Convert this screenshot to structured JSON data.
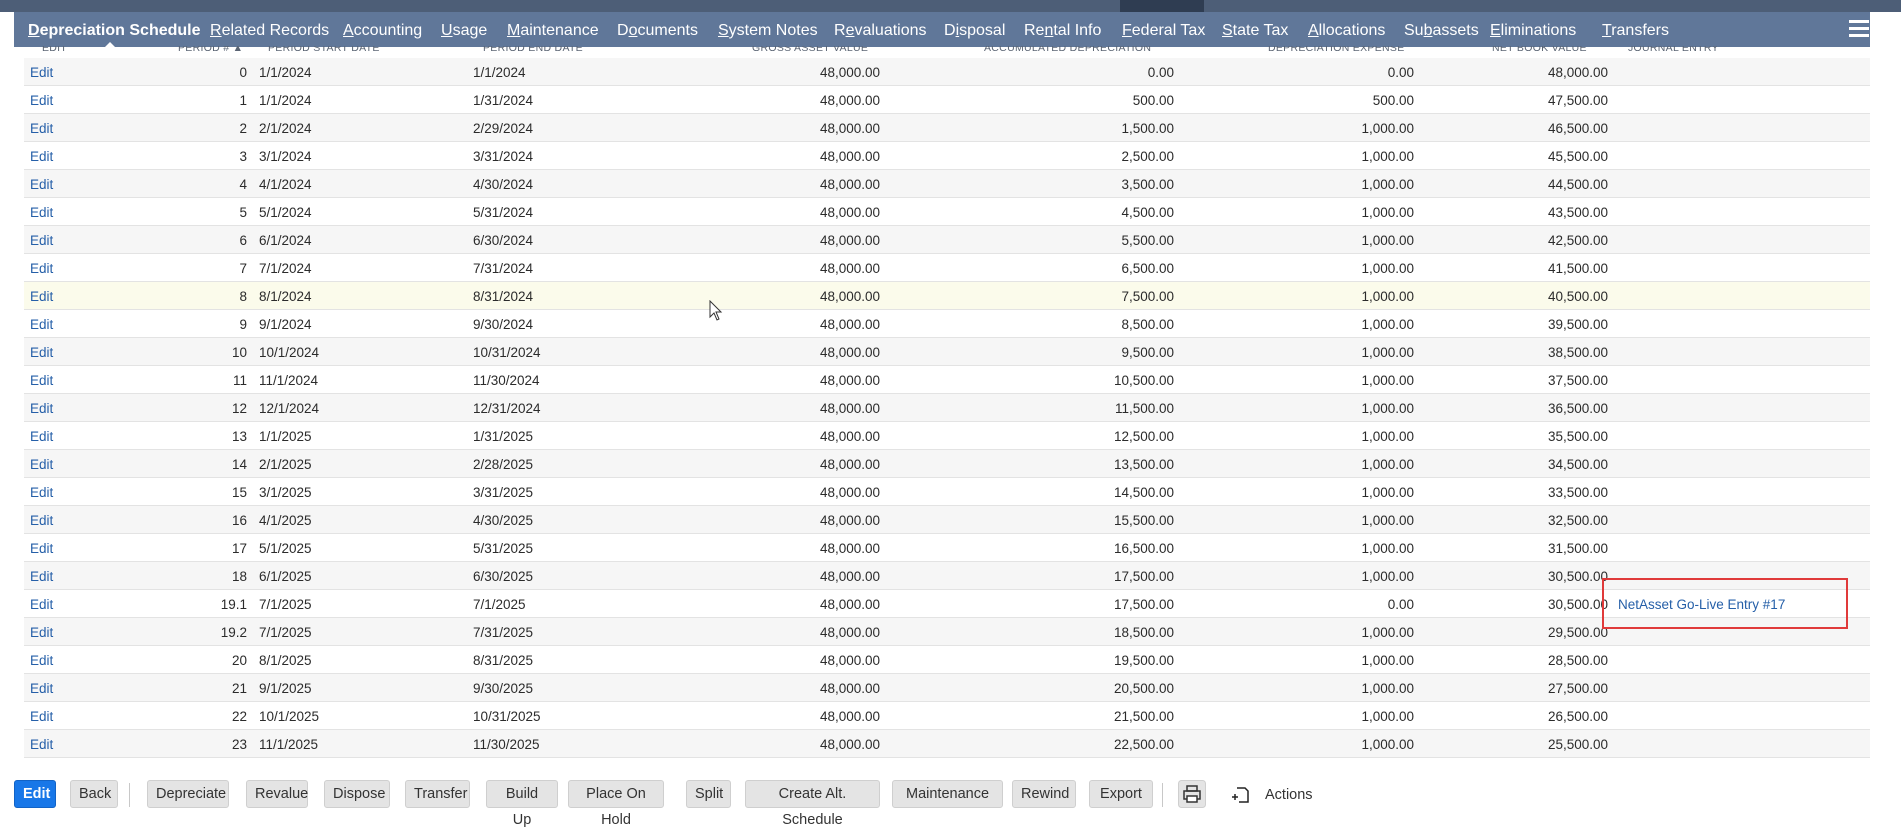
{
  "tabs": [
    {
      "pre": "",
      "u": "D",
      "post": "epreciation Schedule",
      "active": true
    },
    {
      "pre": "",
      "u": "R",
      "post": "elated Records",
      "active": false
    },
    {
      "pre": "",
      "u": "A",
      "post": "ccounting",
      "active": false
    },
    {
      "pre": "",
      "u": "U",
      "post": "sage",
      "active": false
    },
    {
      "pre": "",
      "u": "M",
      "post": "aintenance",
      "active": false
    },
    {
      "pre": "D",
      "u": "o",
      "post": "cuments",
      "active": false
    },
    {
      "pre": "",
      "u": "S",
      "post": "ystem Notes",
      "active": false
    },
    {
      "pre": "R",
      "u": "e",
      "post": "valuations",
      "active": false
    },
    {
      "pre": "D",
      "u": "i",
      "post": "sposal",
      "active": false
    },
    {
      "pre": "Re",
      "u": "n",
      "post": "tal Info",
      "active": false
    },
    {
      "pre": "",
      "u": "F",
      "post": "ederal Tax",
      "active": false
    },
    {
      "pre": "",
      "u": "S",
      "post": "tate Tax",
      "active": false
    },
    {
      "pre": "",
      "u": "A",
      "post": "llocations",
      "active": false
    },
    {
      "pre": "Su",
      "u": "b",
      "post": "assets",
      "active": false
    },
    {
      "pre": "",
      "u": "E",
      "post": "liminations",
      "active": false
    },
    {
      "pre": "",
      "u": "T",
      "post": "ransfers",
      "active": false
    }
  ],
  "columns": [
    "EDIT",
    "PERIOD # ▲",
    "PERIOD START DATE",
    "PERIOD END DATE",
    "GROSS ASSET VALUE",
    "ACCUMULATED DEPRECIATION",
    "DEPRECIATION EXPENSE",
    "NET BOOK VALUE",
    "JOURNAL ENTRY"
  ],
  "edit_label": "Edit",
  "rows": [
    {
      "period": "0",
      "start": "1/1/2024",
      "end": "1/1/2024",
      "gross": "48,000.00",
      "accum": "0.00",
      "expense": "0.00",
      "nbv": "48,000.00",
      "je": ""
    },
    {
      "period": "1",
      "start": "1/1/2024",
      "end": "1/31/2024",
      "gross": "48,000.00",
      "accum": "500.00",
      "expense": "500.00",
      "nbv": "47,500.00",
      "je": ""
    },
    {
      "period": "2",
      "start": "2/1/2024",
      "end": "2/29/2024",
      "gross": "48,000.00",
      "accum": "1,500.00",
      "expense": "1,000.00",
      "nbv": "46,500.00",
      "je": ""
    },
    {
      "period": "3",
      "start": "3/1/2024",
      "end": "3/31/2024",
      "gross": "48,000.00",
      "accum": "2,500.00",
      "expense": "1,000.00",
      "nbv": "45,500.00",
      "je": ""
    },
    {
      "period": "4",
      "start": "4/1/2024",
      "end": "4/30/2024",
      "gross": "48,000.00",
      "accum": "3,500.00",
      "expense": "1,000.00",
      "nbv": "44,500.00",
      "je": ""
    },
    {
      "period": "5",
      "start": "5/1/2024",
      "end": "5/31/2024",
      "gross": "48,000.00",
      "accum": "4,500.00",
      "expense": "1,000.00",
      "nbv": "43,500.00",
      "je": ""
    },
    {
      "period": "6",
      "start": "6/1/2024",
      "end": "6/30/2024",
      "gross": "48,000.00",
      "accum": "5,500.00",
      "expense": "1,000.00",
      "nbv": "42,500.00",
      "je": ""
    },
    {
      "period": "7",
      "start": "7/1/2024",
      "end": "7/31/2024",
      "gross": "48,000.00",
      "accum": "6,500.00",
      "expense": "1,000.00",
      "nbv": "41,500.00",
      "je": ""
    },
    {
      "period": "8",
      "start": "8/1/2024",
      "end": "8/31/2024",
      "gross": "48,000.00",
      "accum": "7,500.00",
      "expense": "1,000.00",
      "nbv": "40,500.00",
      "je": ""
    },
    {
      "period": "9",
      "start": "9/1/2024",
      "end": "9/30/2024",
      "gross": "48,000.00",
      "accum": "8,500.00",
      "expense": "1,000.00",
      "nbv": "39,500.00",
      "je": ""
    },
    {
      "period": "10",
      "start": "10/1/2024",
      "end": "10/31/2024",
      "gross": "48,000.00",
      "accum": "9,500.00",
      "expense": "1,000.00",
      "nbv": "38,500.00",
      "je": ""
    },
    {
      "period": "11",
      "start": "11/1/2024",
      "end": "11/30/2024",
      "gross": "48,000.00",
      "accum": "10,500.00",
      "expense": "1,000.00",
      "nbv": "37,500.00",
      "je": ""
    },
    {
      "period": "12",
      "start": "12/1/2024",
      "end": "12/31/2024",
      "gross": "48,000.00",
      "accum": "11,500.00",
      "expense": "1,000.00",
      "nbv": "36,500.00",
      "je": ""
    },
    {
      "period": "13",
      "start": "1/1/2025",
      "end": "1/31/2025",
      "gross": "48,000.00",
      "accum": "12,500.00",
      "expense": "1,000.00",
      "nbv": "35,500.00",
      "je": ""
    },
    {
      "period": "14",
      "start": "2/1/2025",
      "end": "2/28/2025",
      "gross": "48,000.00",
      "accum": "13,500.00",
      "expense": "1,000.00",
      "nbv": "34,500.00",
      "je": ""
    },
    {
      "period": "15",
      "start": "3/1/2025",
      "end": "3/31/2025",
      "gross": "48,000.00",
      "accum": "14,500.00",
      "expense": "1,000.00",
      "nbv": "33,500.00",
      "je": ""
    },
    {
      "period": "16",
      "start": "4/1/2025",
      "end": "4/30/2025",
      "gross": "48,000.00",
      "accum": "15,500.00",
      "expense": "1,000.00",
      "nbv": "32,500.00",
      "je": ""
    },
    {
      "period": "17",
      "start": "5/1/2025",
      "end": "5/31/2025",
      "gross": "48,000.00",
      "accum": "16,500.00",
      "expense": "1,000.00",
      "nbv": "31,500.00",
      "je": ""
    },
    {
      "period": "18",
      "start": "6/1/2025",
      "end": "6/30/2025",
      "gross": "48,000.00",
      "accum": "17,500.00",
      "expense": "1,000.00",
      "nbv": "30,500.00",
      "je": ""
    },
    {
      "period": "19.1",
      "start": "7/1/2025",
      "end": "7/1/2025",
      "gross": "48,000.00",
      "accum": "17,500.00",
      "expense": "0.00",
      "nbv": "30,500.00",
      "je": "NetAsset Go-Live Entry #17"
    },
    {
      "period": "19.2",
      "start": "7/1/2025",
      "end": "7/31/2025",
      "gross": "48,000.00",
      "accum": "18,500.00",
      "expense": "1,000.00",
      "nbv": "29,500.00",
      "je": ""
    },
    {
      "period": "20",
      "start": "8/1/2025",
      "end": "8/31/2025",
      "gross": "48,000.00",
      "accum": "19,500.00",
      "expense": "1,000.00",
      "nbv": "28,500.00",
      "je": ""
    },
    {
      "period": "21",
      "start": "9/1/2025",
      "end": "9/30/2025",
      "gross": "48,000.00",
      "accum": "20,500.00",
      "expense": "1,000.00",
      "nbv": "27,500.00",
      "je": ""
    },
    {
      "period": "22",
      "start": "10/1/2025",
      "end": "10/31/2025",
      "gross": "48,000.00",
      "accum": "21,500.00",
      "expense": "1,000.00",
      "nbv": "26,500.00",
      "je": ""
    },
    {
      "period": "23",
      "start": "11/1/2025",
      "end": "11/30/2025",
      "gross": "48,000.00",
      "accum": "22,500.00",
      "expense": "1,000.00",
      "nbv": "25,500.00",
      "je": ""
    }
  ],
  "buttons": [
    "Edit",
    "Back",
    "Depreciate",
    "Revalue",
    "Dispose",
    "Transfer",
    "Build Up",
    "Place On Hold",
    "Split",
    "Create Alt. Schedule",
    "Maintenance",
    "Rewind",
    "Export"
  ],
  "actions_label": "Actions",
  "icons": {
    "print": "print-icon",
    "actions": "actions-menu-icon",
    "menu": "hamburger-menu-icon",
    "cursor": "mouse-cursor-icon"
  },
  "colors": {
    "tab_bar": "#607799",
    "link": "#255fa8",
    "primary_button": "#1877e8",
    "highlight_box": "#e03a3a",
    "hover_row": "#fbfbeb"
  }
}
